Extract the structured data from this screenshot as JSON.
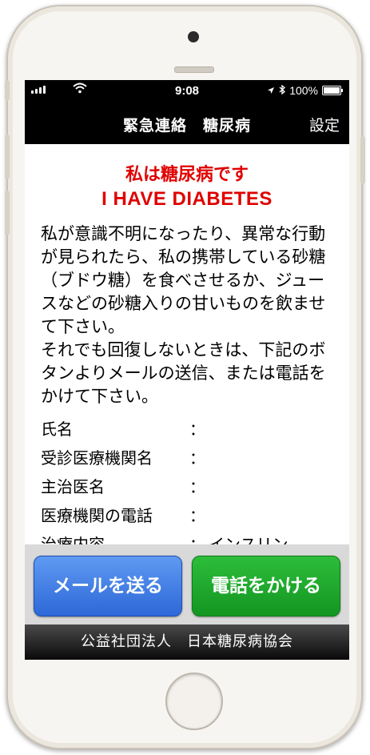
{
  "status_bar": {
    "time": "9:08",
    "battery": "100%",
    "location_icon": "location-arrow-icon",
    "bluetooth_icon": "bluetooth-icon"
  },
  "nav": {
    "title": "緊急連絡　糖尿病",
    "settings": "設定"
  },
  "heading": {
    "ja": "私は糖尿病です",
    "en": "I HAVE DIABETES",
    "color": "#e00000"
  },
  "message": {
    "line1": "私が意識不明になったり、異常な行動が見られたら、私の携帯している砂糖（ブドウ糖）を食べさせるか、ジュースなどの砂糖入りの甘いものを飲ませて下さい。",
    "line2": "それでも回復しないときは、下記のボタンよりメールの送信、または電話をかけて下さい。"
  },
  "info": [
    {
      "label": "氏名",
      "colon": "：",
      "value": ""
    },
    {
      "label": "受診医療機関名",
      "colon": "：",
      "value": ""
    },
    {
      "label": "主治医名",
      "colon": "：",
      "value": ""
    },
    {
      "label": "医療機関の電話",
      "colon": "：",
      "value": ""
    },
    {
      "label": "治療内容",
      "colon": "：",
      "value": "インスリン"
    }
  ],
  "buttons": {
    "mail": "メールを送る",
    "phone": "電話をかける",
    "mail_color": "#2d68d8",
    "phone_color": "#149622"
  },
  "footer": {
    "text": "公益社団法人　日本糖尿病協会"
  }
}
